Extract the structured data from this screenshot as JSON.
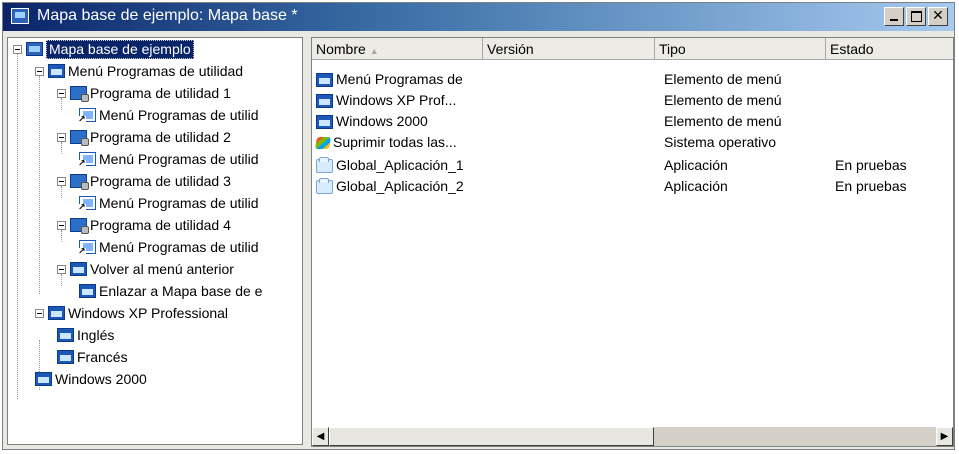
{
  "window": {
    "title": "Mapa base de ejemplo: Mapa base *"
  },
  "tree": {
    "root": "Mapa base de ejemplo",
    "items": [
      {
        "label": "Menú Programas de utilidad",
        "icon": "menu-icon"
      },
      {
        "label": "Programa de utilidad 1",
        "icon": "program-icon"
      },
      {
        "label": "Menú Programas de utilid",
        "icon": "shortcut-icon"
      },
      {
        "label": "Programa de utilidad 2",
        "icon": "program-icon"
      },
      {
        "label": "Menú Programas de utilid",
        "icon": "shortcut-icon"
      },
      {
        "label": "Programa de utilidad 3",
        "icon": "program-icon"
      },
      {
        "label": "Menú Programas de utilid",
        "icon": "shortcut-icon"
      },
      {
        "label": "Programa de utilidad 4",
        "icon": "program-icon"
      },
      {
        "label": "Menú Programas de utilid",
        "icon": "shortcut-icon"
      },
      {
        "label": "Volver al menú  anterior",
        "icon": "menu-icon"
      },
      {
        "label": "Enlazar a Mapa base de e",
        "icon": "menu-icon"
      },
      {
        "label": "Windows XP Professional",
        "icon": "menu-icon"
      },
      {
        "label": "Inglés",
        "icon": "menu-icon"
      },
      {
        "label": "Francés",
        "icon": "menu-icon"
      },
      {
        "label": "Windows 2000",
        "icon": "menu-icon"
      }
    ]
  },
  "list": {
    "columns": [
      "Nombre",
      "Versión",
      "Tipo",
      "Estado"
    ],
    "rows": [
      {
        "name": "Menú Programas de",
        "version": "",
        "type": "Elemento de menú",
        "status": "",
        "icon": "menu-icon"
      },
      {
        "name": "Windows XP Prof...",
        "version": "",
        "type": "Elemento de menú",
        "status": "",
        "icon": "menu-icon"
      },
      {
        "name": "Windows 2000",
        "version": "",
        "type": "Elemento de menú",
        "status": "",
        "icon": "menu-icon"
      },
      {
        "name": "Suprimir todas las...",
        "version": "",
        "type": "Sistema operativo",
        "status": "",
        "icon": "os-icon"
      },
      {
        "name": "Global_Aplicación_1",
        "version": "",
        "type": "Aplicación",
        "status": "En pruebas",
        "icon": "application-icon"
      },
      {
        "name": "Global_Aplicación_2",
        "version": "",
        "type": "Aplicación",
        "status": "En pruebas",
        "icon": "application-icon"
      }
    ]
  },
  "scrollbar": {
    "left_arrow": "◀",
    "right_arrow": "▶"
  }
}
